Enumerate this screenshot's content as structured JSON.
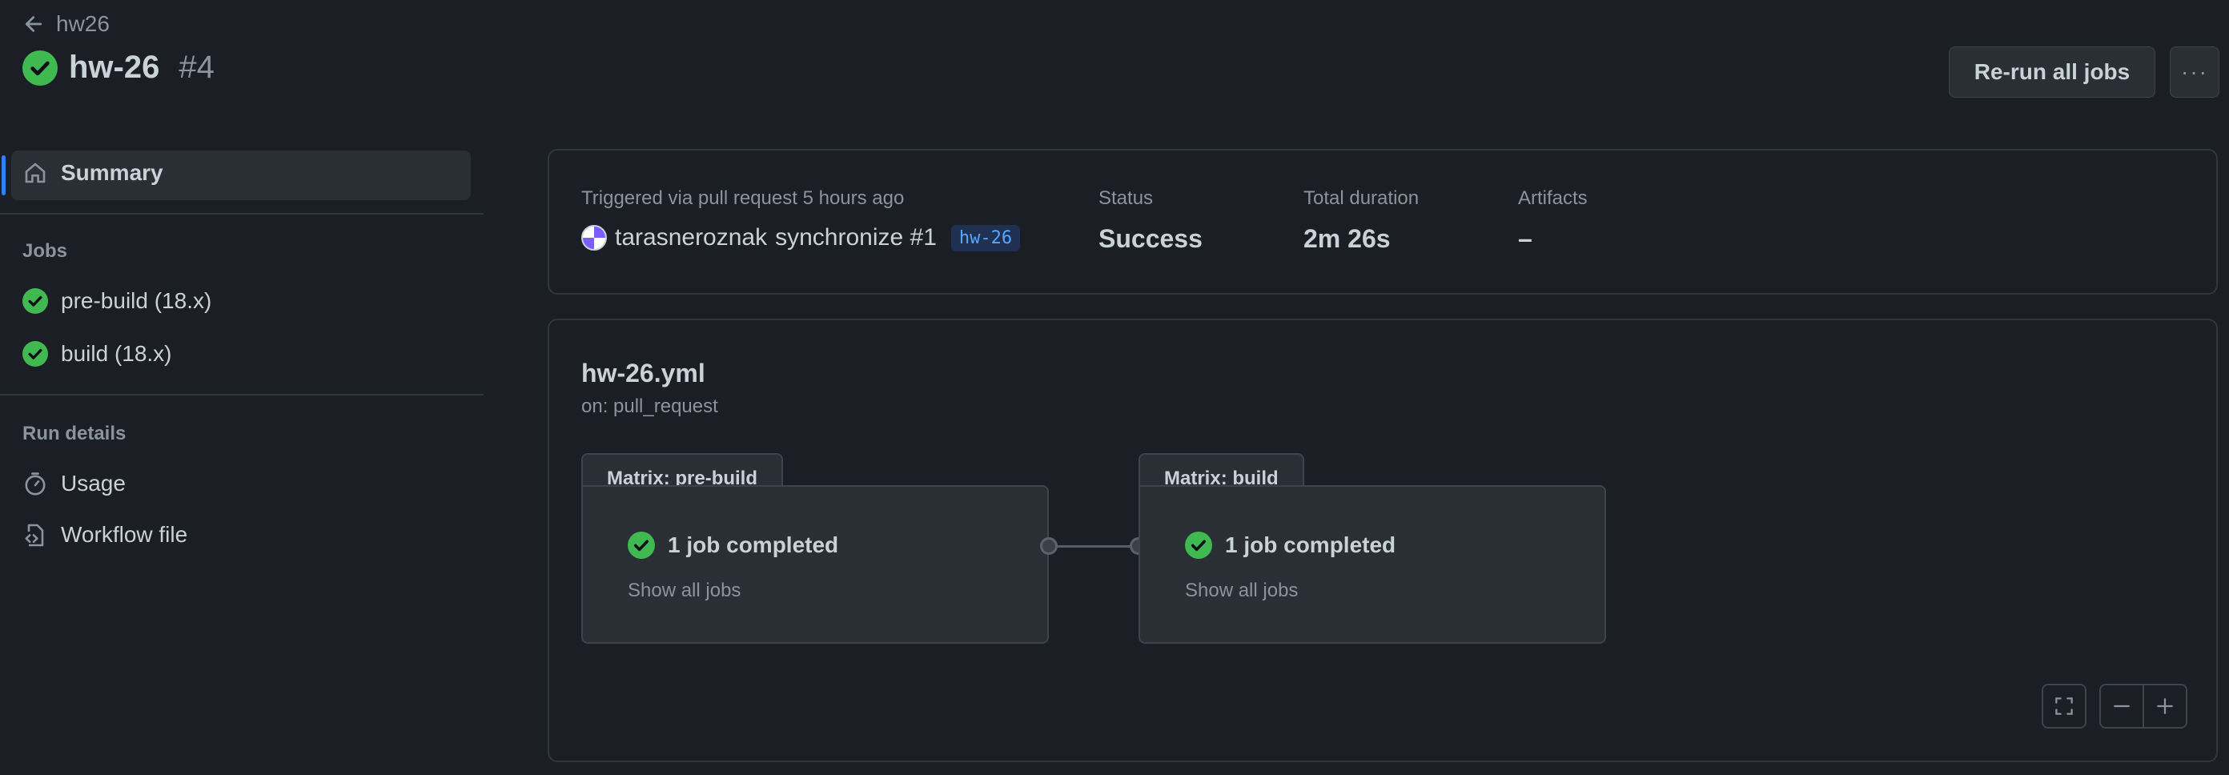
{
  "header": {
    "back_label": "hw26",
    "run_title": "hw-26",
    "run_number": "#4",
    "rerun_label": "Re-run all jobs",
    "more_label": "···"
  },
  "sidebar": {
    "summary_label": "Summary",
    "jobs_heading": "Jobs",
    "jobs": [
      {
        "label": "pre-build (18.x)",
        "status": "success"
      },
      {
        "label": "build (18.x)",
        "status": "success"
      }
    ],
    "run_details_heading": "Run details",
    "details": [
      {
        "label": "Usage",
        "icon": "stopwatch-icon"
      },
      {
        "label": "Workflow file",
        "icon": "file-code-icon"
      }
    ]
  },
  "summary": {
    "trigger_text": "Triggered via pull request 5 hours ago",
    "actor": "tarasneroznak",
    "event": "synchronize #1",
    "branch": "hw-26",
    "status_label": "Status",
    "status_value": "Success",
    "duration_label": "Total duration",
    "duration_value": "2m 26s",
    "artifacts_label": "Artifacts",
    "artifacts_value": "–"
  },
  "workflow": {
    "file_name": "hw-26.yml",
    "trigger": "on: pull_request",
    "matrices": [
      {
        "tab_label": "Matrix: pre-build",
        "status_text": "1 job completed",
        "link": "Show all jobs"
      },
      {
        "tab_label": "Matrix: build",
        "status_text": "1 job completed",
        "link": "Show all jobs"
      }
    ]
  },
  "colors": {
    "success": "#3fb950",
    "accent": "#2f81f7",
    "background": "#1b1e24"
  }
}
